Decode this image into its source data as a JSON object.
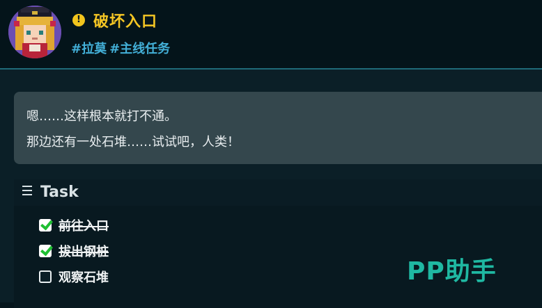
{
  "quest": {
    "alert_symbol": "!",
    "title": "破坏入口",
    "tags": [
      "#拉莫",
      "#主线任务"
    ]
  },
  "dialog": {
    "lines": [
      "嗯……这样根本就打不通。",
      "那边还有一处石堆……试试吧，人类！"
    ]
  },
  "task_panel": {
    "title": "Task",
    "items": [
      {
        "label": "前往入口",
        "done": true
      },
      {
        "label": "拔出钢桩",
        "done": true
      },
      {
        "label": "观察石堆",
        "done": false
      }
    ]
  },
  "watermark": "PP助手",
  "colors": {
    "title": "#f5c624",
    "tag": "#43b0d8",
    "watermark": "#1fb8a2",
    "check": "#1fbf33"
  },
  "icons": {
    "alert": "exclamation-circle-icon",
    "task_menu": "hamburger-menu-icon",
    "checked": "checkbox-checked-icon",
    "unchecked": "checkbox-empty-icon",
    "avatar": "pixel-girl-portrait"
  }
}
